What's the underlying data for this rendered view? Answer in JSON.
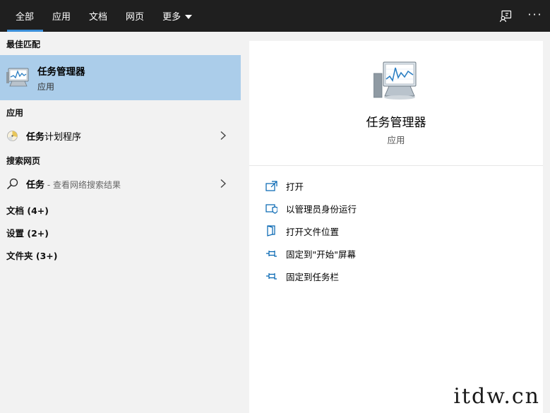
{
  "topbar": {
    "tabs": [
      {
        "label": "全部",
        "active": true
      },
      {
        "label": "应用",
        "active": false
      },
      {
        "label": "文档",
        "active": false
      },
      {
        "label": "网页",
        "active": false
      },
      {
        "label": "更多",
        "active": false,
        "dropdown": true
      }
    ],
    "icons": [
      "feedback-icon",
      "more-options-icon"
    ],
    "more_options_text": "···"
  },
  "left": {
    "best_match_title": "最佳匹配",
    "best_match": {
      "name": "任务管理器",
      "type": "应用",
      "icon": "task-manager-icon"
    },
    "apps_title": "应用",
    "apps": [
      {
        "label_bold": "任务",
        "label_rest": "计划程序",
        "icon": "task-scheduler-icon"
      }
    ],
    "web_title": "搜索网页",
    "web": [
      {
        "label_bold": "任务",
        "label_sub": " - 查看网络搜索结果",
        "icon": "search-icon"
      }
    ],
    "categories": [
      {
        "label": "文档 (4+)"
      },
      {
        "label": "设置 (2+)"
      },
      {
        "label": "文件夹 (3+)"
      }
    ]
  },
  "preview": {
    "name": "任务管理器",
    "type": "应用",
    "icon": "task-manager-icon",
    "actions": [
      {
        "label": "打开",
        "icon": "open-icon"
      },
      {
        "label": "以管理员身份运行",
        "icon": "shield-icon"
      },
      {
        "label": "打开文件位置",
        "icon": "file-location-icon"
      },
      {
        "label": "固定到\"开始\"屏幕",
        "icon": "pin-start-icon"
      },
      {
        "label": "固定到任务栏",
        "icon": "pin-taskbar-icon"
      }
    ]
  },
  "watermark": "itdw.cn",
  "colors": {
    "topbar_bg": "#1f1f1f",
    "active_underline": "#3b8fd9",
    "selection_bg": "#abcdea",
    "left_bg": "#f2f2f2",
    "accent_icon": "#0063b1"
  }
}
